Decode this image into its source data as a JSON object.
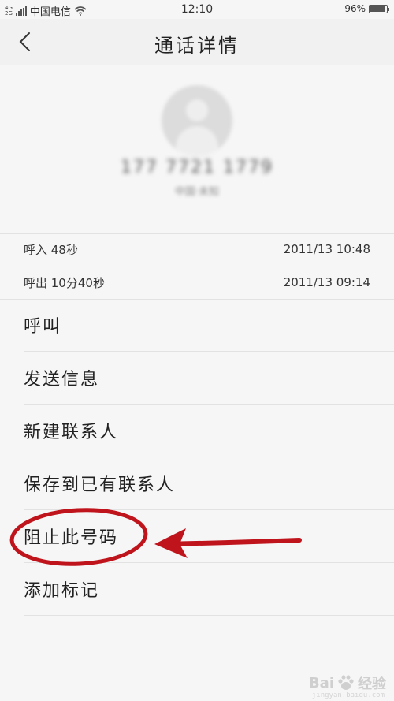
{
  "status_bar": {
    "network_top": "4G",
    "network_bottom": "2G",
    "carrier": "中国电信",
    "time": "12:10",
    "battery": "96%",
    "battery_level": 0.96
  },
  "header": {
    "title": "通话详情"
  },
  "contact": {
    "number": "177 7721 1779",
    "location": "中国·未知"
  },
  "call_log": [
    {
      "type": "呼入 48秒",
      "datetime": "2011/13 10:48"
    },
    {
      "type": "呼出 10分40秒",
      "datetime": "2011/13 09:14"
    }
  ],
  "actions": [
    {
      "label": "呼叫"
    },
    {
      "label": "发送信息"
    },
    {
      "label": "新建联系人"
    },
    {
      "label": "保存到已有联系人"
    },
    {
      "label": "阻止此号码"
    },
    {
      "label": "添加标记"
    }
  ],
  "annotation_color": "#c0141c",
  "watermark": {
    "brand": "Bai",
    "brand2": "经验",
    "url": "jingyan.baidu.com"
  }
}
